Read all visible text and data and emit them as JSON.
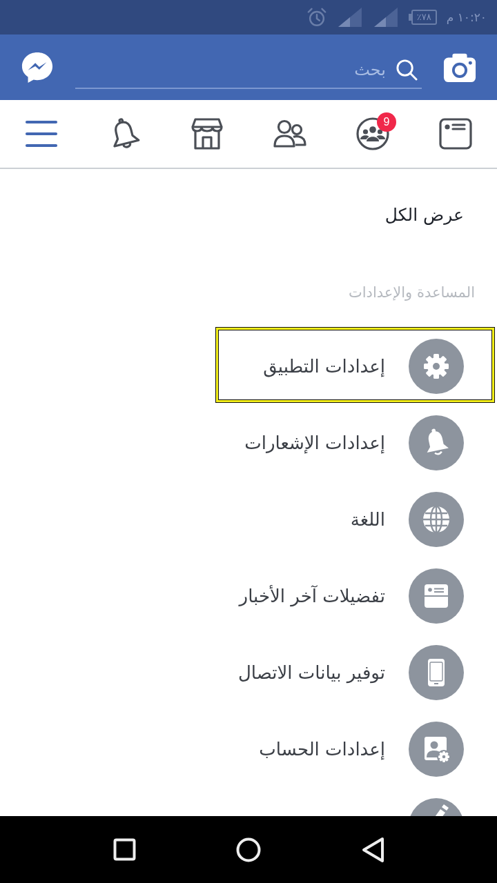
{
  "status_bar": {
    "time": "١٠:٢٠ م",
    "battery": "٪٧٨"
  },
  "header": {
    "search": {
      "placeholder": "بحث"
    }
  },
  "tabs": [
    {
      "kind": "feed",
      "selected": false
    },
    {
      "kind": "groups",
      "selected": false,
      "badge": "9"
    },
    {
      "kind": "friends",
      "selected": false
    },
    {
      "kind": "marketplace",
      "selected": false
    },
    {
      "kind": "notifications",
      "selected": false
    },
    {
      "kind": "menu",
      "selected": true
    }
  ],
  "see_all": "عرض الكل",
  "help_settings": {
    "heading": "المساعدة والإعدادات",
    "items": [
      {
        "kind": "gear",
        "label": "إعدادات التطبيق",
        "highlighted": true
      },
      {
        "kind": "bell",
        "label": "إعدادات الإشعارات",
        "highlighted": false
      },
      {
        "kind": "globe",
        "label": "اللغة",
        "highlighted": false
      },
      {
        "kind": "feed",
        "label": "تفضيلات آخر الأخبار",
        "highlighted": false
      },
      {
        "kind": "phone",
        "label": "توفير بيانات الاتصال",
        "highlighted": false
      },
      {
        "kind": "account",
        "label": "إعدادات الحساب",
        "highlighted": false
      },
      {
        "kind": "edit",
        "highlighted": false
      }
    ]
  }
}
